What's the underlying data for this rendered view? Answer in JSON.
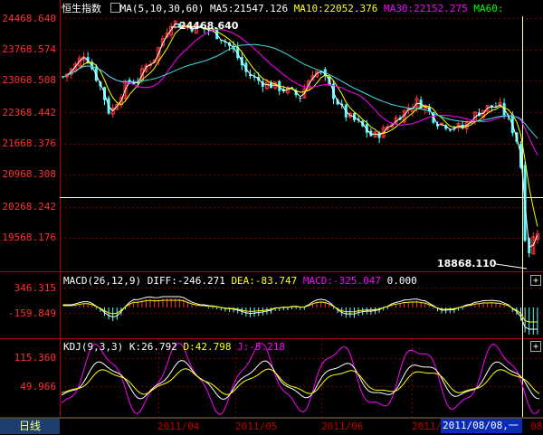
{
  "header": {
    "title": "恒生指数",
    "ma_label": "MA(5,10,30,60)",
    "ma5": "MA5:21547.126",
    "ma10": "MA10:22052.376",
    "ma30": "MA30:22152.275",
    "ma60": "MA60:"
  },
  "price_axis": [
    "24468.640",
    "23768.574",
    "23068.508",
    "22368.442",
    "21668.376",
    "20968.308",
    "20268.242",
    "19568.176"
  ],
  "annotations": {
    "high": "24468.640",
    "low": "18868.110"
  },
  "macd": {
    "label": "MACD(26,12,9)",
    "diff": "DIFF:-246.271",
    "dea": "DEA:-83.747",
    "macd": "MACD:-325.047",
    "zero": "0.000",
    "axis": [
      "346.315",
      "-159.849"
    ]
  },
  "kdj": {
    "label": "KDJ(9,3,3)",
    "k": "K:26.792",
    "d": "D:42.798",
    "j": "J:-5.218",
    "axis": [
      "115.360",
      "49.966"
    ]
  },
  "bottom": {
    "tab_label": "日线",
    "dates": [
      "2011/04",
      "2011/05",
      "2011/06",
      "2011/"
    ],
    "cursor_date": "2011/08/08,一",
    "tail": "08"
  },
  "buttons": {
    "plus": "+"
  },
  "colors": {
    "up": "#ff3232",
    "down": "#54ffff",
    "ma5": "#ffffff",
    "ma10": "#ffff00",
    "ma30": "#ff00ff",
    "ma60": "#00ff00",
    "grid": "#7a0000",
    "axis_text": "#ff3030"
  }
}
